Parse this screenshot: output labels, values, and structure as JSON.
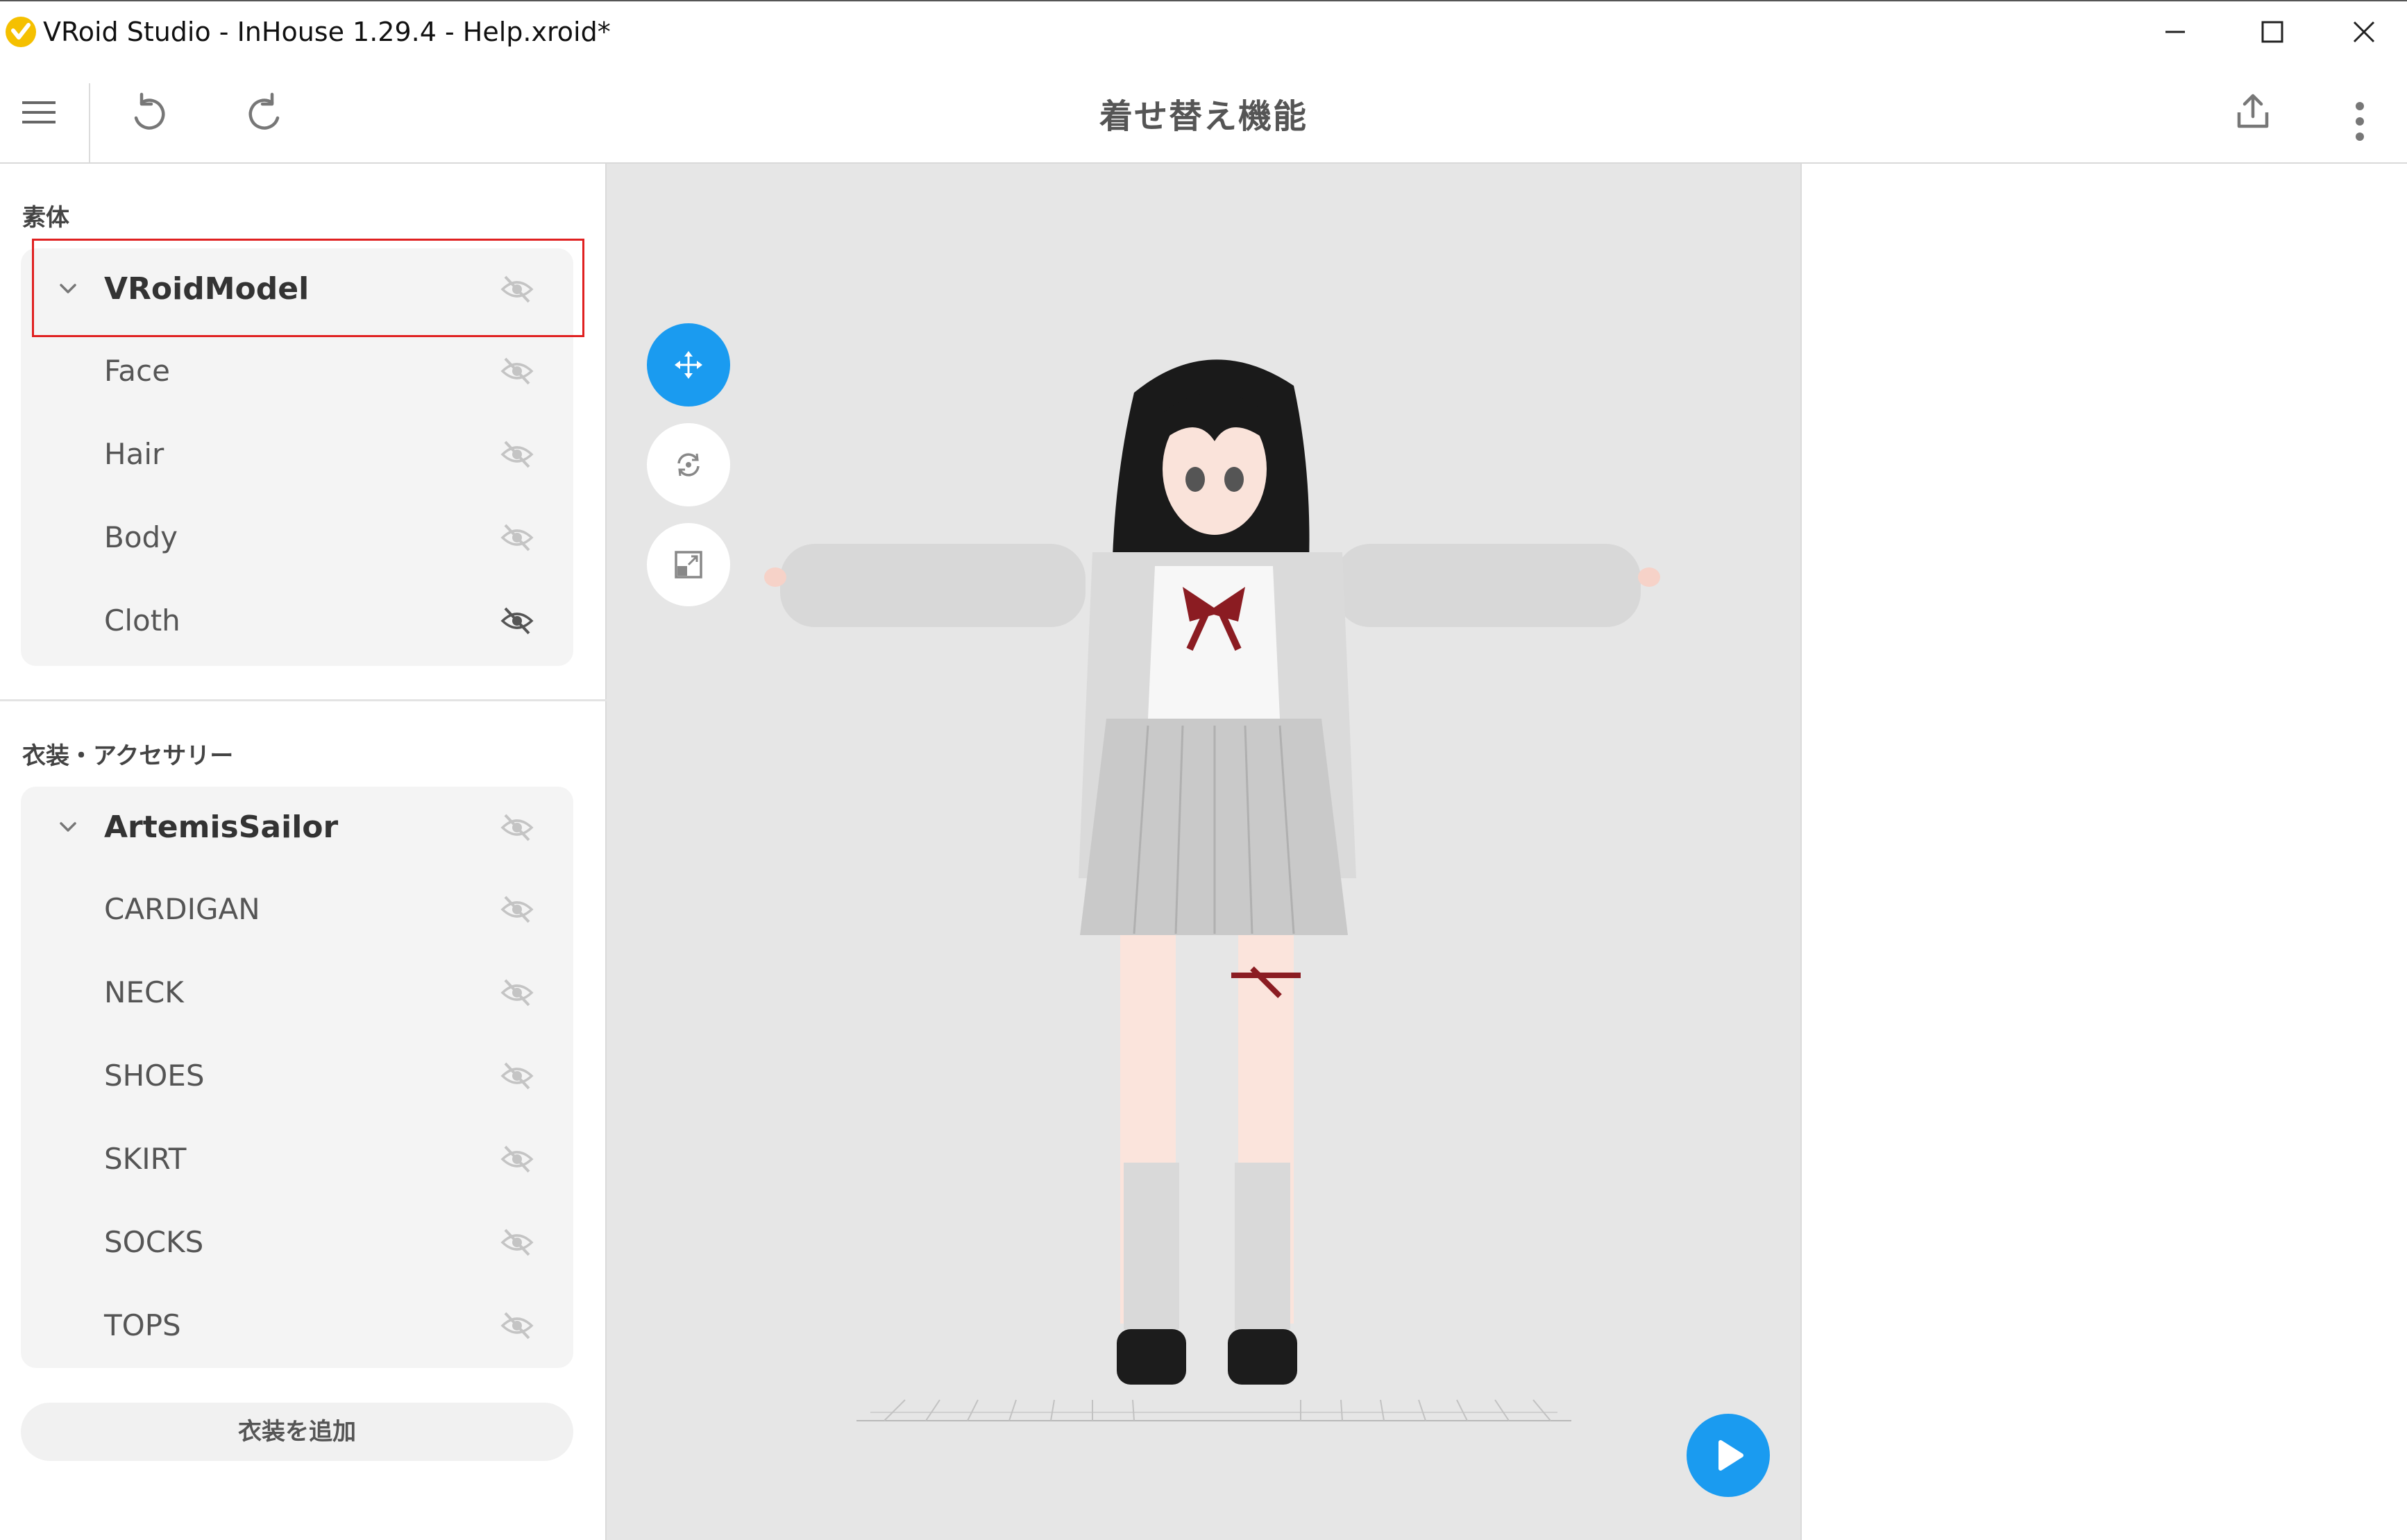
{
  "window": {
    "title": "VRoid Studio - InHouse 1.29.4 - Help.xroid*"
  },
  "toolbar": {
    "page_title": "着せ替え機能",
    "icons": [
      "hamburger-menu-icon",
      "undo-icon",
      "redo-icon",
      "export-icon",
      "more-vertical-icon"
    ]
  },
  "left_panel": {
    "body_section": {
      "label": "素体",
      "group": {
        "name": "VRoidModel",
        "items": [
          {
            "label": "Face"
          },
          {
            "label": "Hair"
          },
          {
            "label": "Body"
          },
          {
            "label": "Cloth"
          }
        ]
      }
    },
    "costume_section": {
      "label": "衣装・アクセサリー",
      "group": {
        "name": "ArtemisSailor",
        "items": [
          {
            "label": "CARDIGAN"
          },
          {
            "label": "NECK"
          },
          {
            "label": "SHOES"
          },
          {
            "label": "SKIRT"
          },
          {
            "label": "SOCKS"
          },
          {
            "label": "TOPS"
          }
        ]
      }
    },
    "add_button_label": "衣装を追加"
  },
  "viewport": {
    "tools": [
      "move-tool-icon",
      "rotate-tool-icon",
      "zoom-tool-icon"
    ],
    "play_icon": "play-icon"
  },
  "colors": {
    "accent": "#1a9bf0",
    "highlight_border": "#e02020"
  }
}
